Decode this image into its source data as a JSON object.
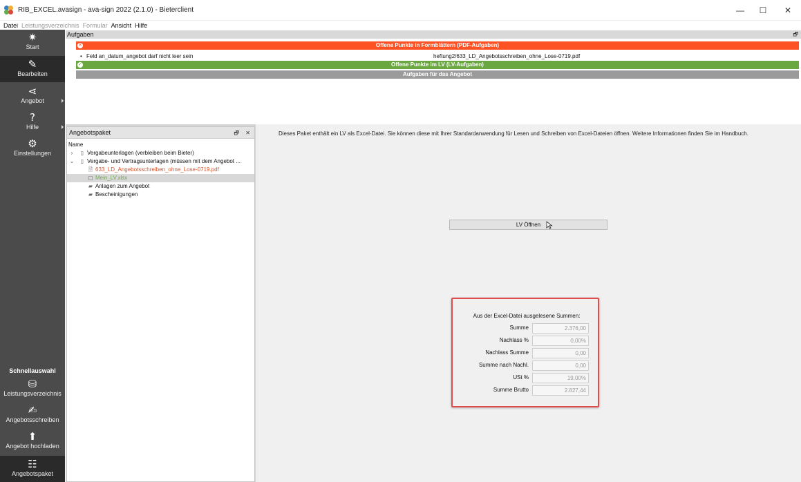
{
  "window": {
    "title": "RIB_EXCEL.avasign - ava-sign 2022 (2.1.0) - Bieterclient",
    "minimize": "—",
    "maximize": "☐",
    "close": "✕"
  },
  "menu": [
    {
      "label": "Datei",
      "enabled": true
    },
    {
      "label": "Leistungsverzeichnis",
      "enabled": false
    },
    {
      "label": "Formular",
      "enabled": false
    },
    {
      "label": "Ansicht",
      "enabled": true
    },
    {
      "label": "Hilfe",
      "enabled": true
    }
  ],
  "sidebar": {
    "items": [
      {
        "label": "Start",
        "icon": "start-icon",
        "glyph": "✷"
      },
      {
        "label": "Bearbeiten",
        "icon": "pencil-icon",
        "glyph": "✎"
      },
      {
        "label": "Angebot",
        "icon": "share-icon",
        "glyph": "⋖"
      },
      {
        "label": "Hilfe",
        "icon": "help-icon",
        "glyph": "?"
      },
      {
        "label": "Einstellungen",
        "icon": "gear-icon",
        "glyph": "⚙"
      }
    ],
    "quick_title": "Schnellauswahl",
    "quick": [
      {
        "label": "Leistungsverzeichnis",
        "icon": "coins-icon",
        "glyph": "⛁"
      },
      {
        "label": "Angebotsschreiben",
        "icon": "edit-document-icon",
        "glyph": "✍"
      },
      {
        "label": "Angebot hochladen",
        "icon": "upload-icon",
        "glyph": "⬆"
      },
      {
        "label": "Angebotspaket",
        "icon": "tree-icon",
        "glyph": "☷"
      }
    ]
  },
  "aufgaben": {
    "title": "Aufgaben",
    "pdf_tasks_label": "Offene Punkte in Formblättern (PDF-Aufgaben)",
    "issue_text": "Feld an_datum_angebot darf nicht leer sein",
    "issue_file": "heftung2/633_LD_Angebotsschreiben_ohne_Lose-0719.pdf",
    "lv_tasks_label": "Offene Punkte im LV (LV-Aufgaben)",
    "offer_tasks_label": "Aufgaben für das Angebot",
    "colors": {
      "error": "#fd5224",
      "ok": "#6aa741",
      "neutral": "#9b9b9b"
    }
  },
  "paket": {
    "title": "Angebotspaket",
    "column": "Name",
    "tree": [
      {
        "label": "Vergabeunterlagen (verbleiben beim Bieter)"
      },
      {
        "label": "Vergabe- und Vertragsunterlagen (müssen mit dem Angebot ..."
      },
      {
        "label": "633_LD_Angebotsschreiben_ohne_Lose-0719.pdf"
      },
      {
        "label": "Mein_LV.xlsx"
      },
      {
        "label": "Anlagen zum Angebot"
      },
      {
        "label": "Bescheinigungen"
      }
    ]
  },
  "main": {
    "info": "Dieses Paket enthält ein LV als Excel-Datei. Sie können diese mit Ihrer Standardanwendung für Lesen und Schreiben von Excel-Dateien öffnen. Weitere Informationen finden Sie im Handbuch.",
    "open_button": "LV Öffnen",
    "sums_title": "Aus der Excel-Datei ausgelesene Summen:",
    "sums": [
      {
        "label": "Summe",
        "value": "2.376,00"
      },
      {
        "label": "Nachlass %",
        "value": "0,00%"
      },
      {
        "label": "Nachlass Summe",
        "value": "0,00"
      },
      {
        "label": "Summe nach Nachl.",
        "value": "0,00"
      },
      {
        "label": "USt %",
        "value": "19,00%"
      },
      {
        "label": "Summe Brutto",
        "value": "2.827,44"
      }
    ]
  }
}
